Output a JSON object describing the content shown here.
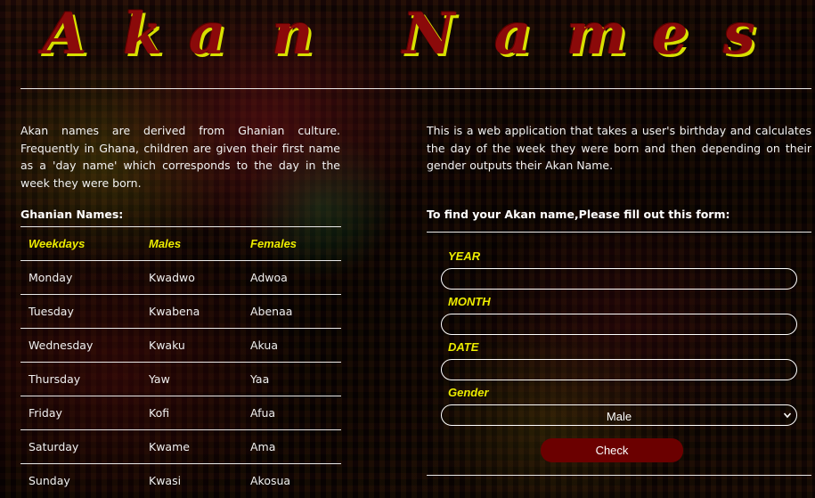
{
  "title_letters": [
    "A",
    "k",
    "a",
    "n",
    "N",
    "a",
    "m",
    "e",
    "s"
  ],
  "title": "Akan Names",
  "intro_left": "Akan names are derived from Ghanian culture. Frequently in Ghana, children are given their first name as a 'day name' which corresponds to the day in the week they were born.",
  "intro_right": "This is a web application that takes a user's birthday and calculates the day of the week they were born and then depending on their gender outputs their Akan Name.",
  "table_heading": "Ghanian Names:",
  "table": {
    "headers": [
      "Weekdays",
      "Males",
      "Females"
    ],
    "rows": [
      [
        "Monday",
        "Kwadwo",
        "Adwoa"
      ],
      [
        "Tuesday",
        "Kwabena",
        "Abenaa"
      ],
      [
        "Wednesday",
        "Kwaku",
        "Akua"
      ],
      [
        "Thursday",
        "Yaw",
        "Yaa"
      ],
      [
        "Friday",
        "Kofi",
        "Afua"
      ],
      [
        "Saturday",
        "Kwame",
        "Ama"
      ],
      [
        "Sunday",
        "Kwasi",
        "Akosua"
      ]
    ]
  },
  "form": {
    "heading": "To find your Akan name,Please fill out this form:",
    "year_label": "YEAR",
    "year_value": "",
    "month_label": "MONTH",
    "month_value": "",
    "date_label": "DATE",
    "date_value": "",
    "gender_label": "Gender",
    "gender_selected": "Male",
    "submit_label": "Check"
  },
  "colors": {
    "title_fill": "#8b0a0a",
    "title_shadow": "#d8e000",
    "accent_yellow": "#ecec00",
    "button_bg": "#6b0000"
  }
}
